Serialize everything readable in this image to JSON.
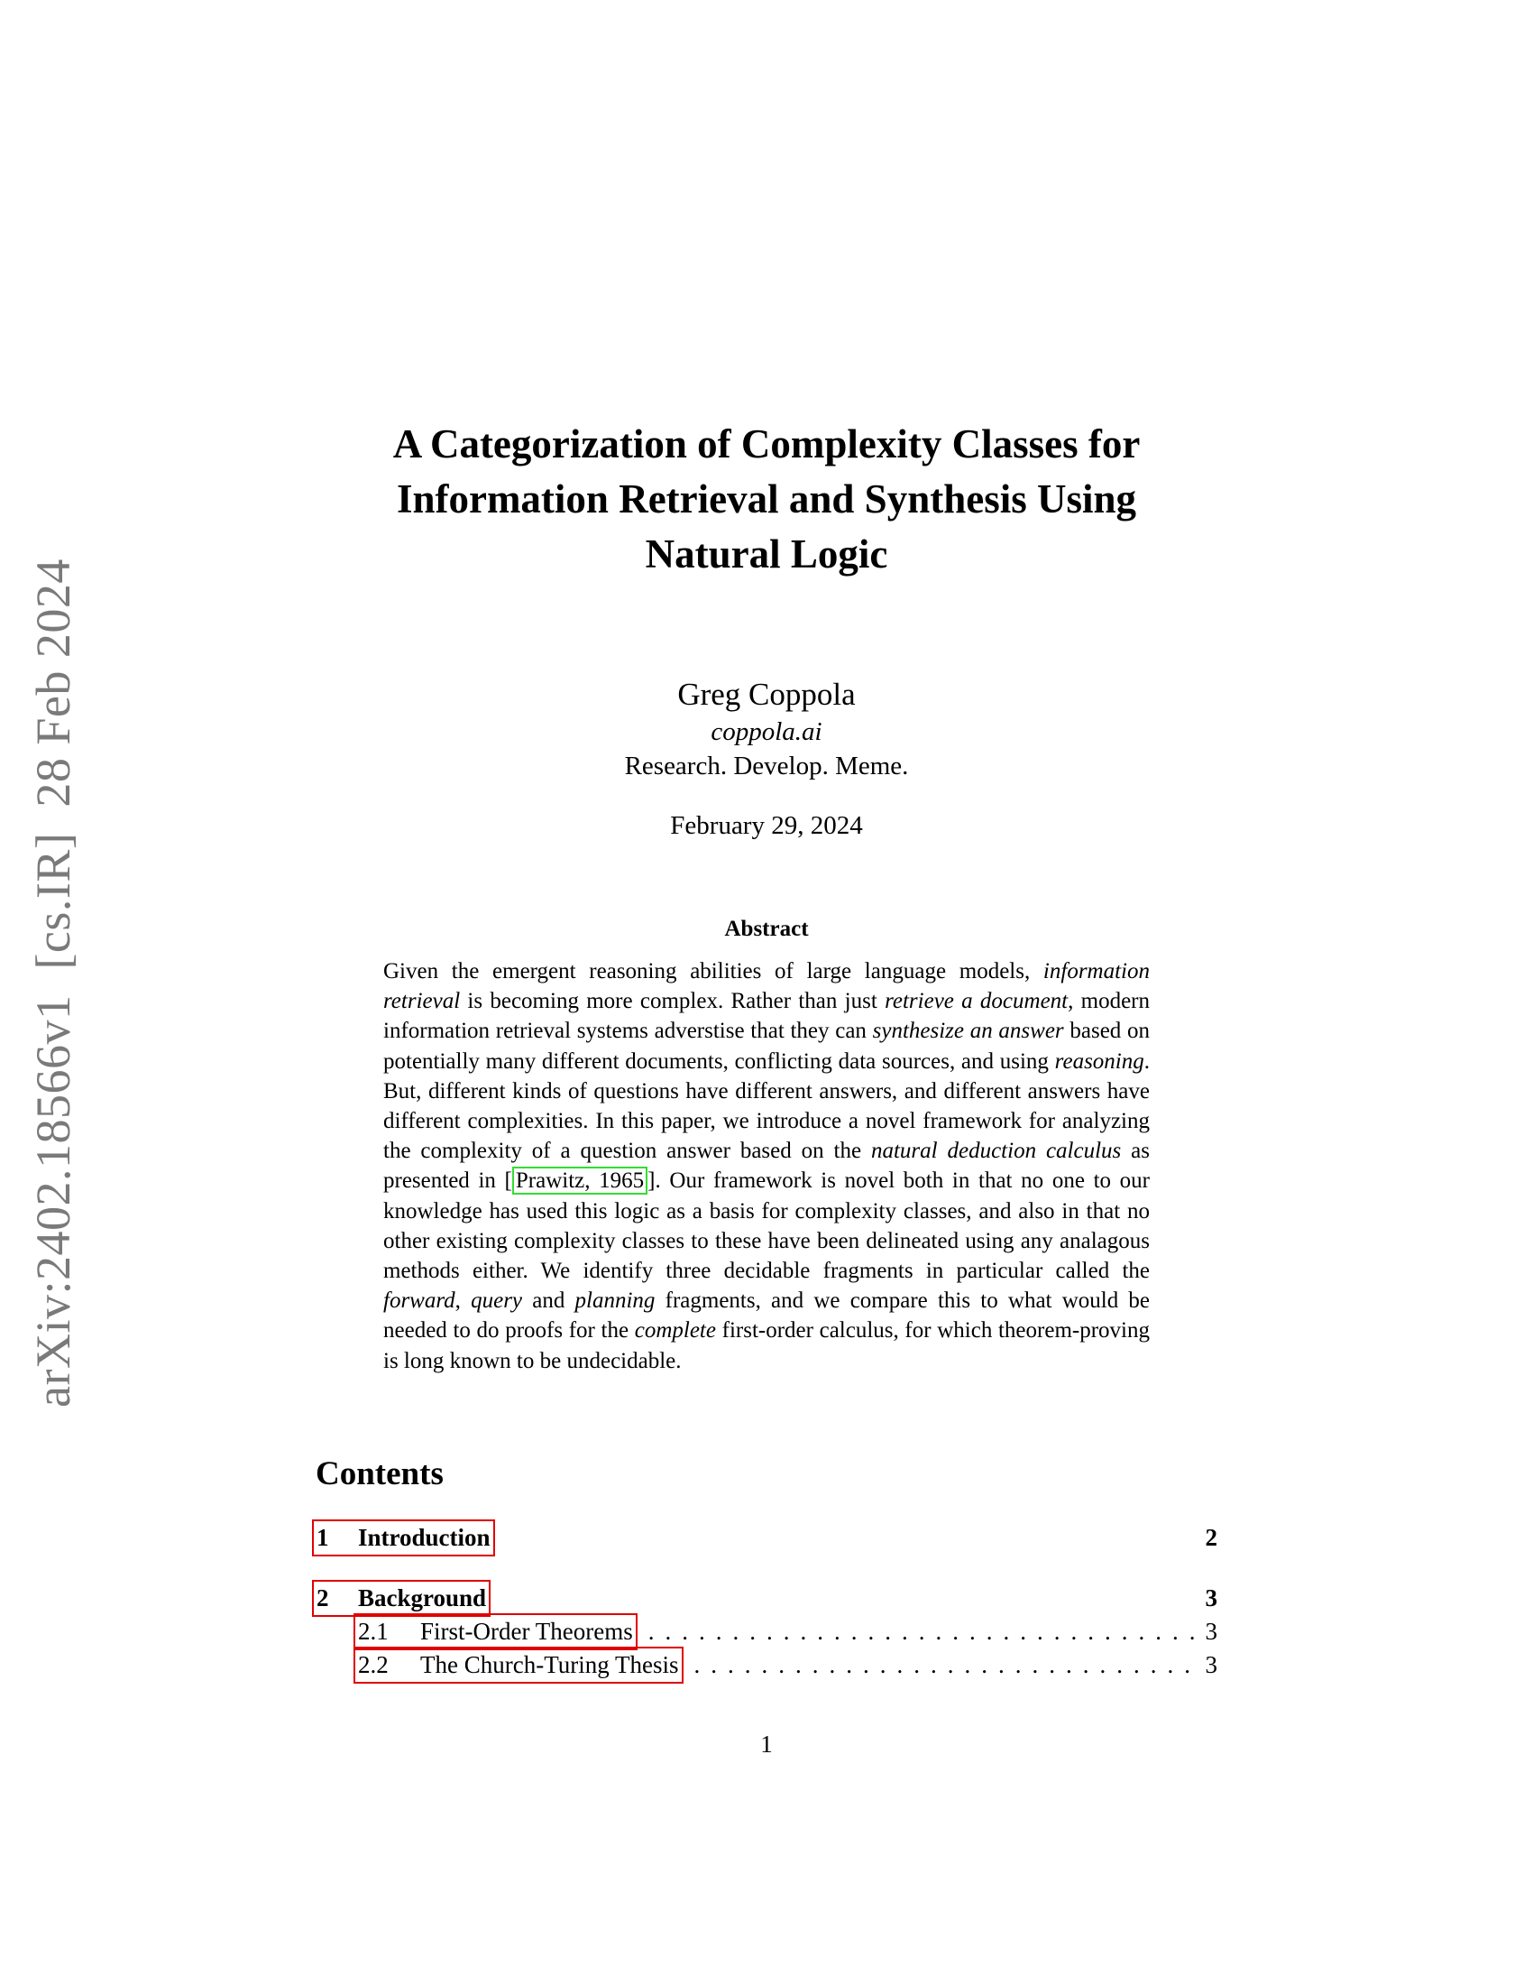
{
  "arxiv_stamp": "arXiv:2402.18566v1  [cs.IR]  28 Feb 2024",
  "title": {
    "lines": [
      "A Categorization of Complexity Classes for",
      "Information Retrieval and Synthesis Using",
      "Natural Logic"
    ]
  },
  "author": {
    "name": "Greg Coppola",
    "affiliation": "coppola.ai",
    "motto": "Research. Develop. Meme.",
    "date": "February 29, 2024"
  },
  "abstract": {
    "heading": "Abstract",
    "segments": [
      {
        "text": "Given the emergent reasoning abilities of large language models, ",
        "style": "normal"
      },
      {
        "text": "information retrieval",
        "style": "italic"
      },
      {
        "text": " is becoming more complex. Rather than just ",
        "style": "normal"
      },
      {
        "text": "retrieve a document",
        "style": "italic"
      },
      {
        "text": ", modern information retrieval systems adverstise that they can ",
        "style": "normal"
      },
      {
        "text": "synthesize an answer",
        "style": "italic"
      },
      {
        "text": " based on potentially many different documents, conflicting data sources, and using ",
        "style": "normal"
      },
      {
        "text": "reasoning",
        "style": "italic"
      },
      {
        "text": ". But, different kinds of questions have different answers, and different answers have different complexities. In this paper, we introduce a novel framework for analyzing the complexity of a question answer based on the ",
        "style": "normal"
      },
      {
        "text": "natural deduction calculus",
        "style": "italic"
      },
      {
        "text": " as presented in [",
        "style": "normal"
      },
      {
        "text": "Prawitz, 1965",
        "style": "citation"
      },
      {
        "text": "]. Our framework is novel both in that no one to our knowledge has used this logic as a basis for complexity classes, and also in that no other existing complexity classes to these have been delineated using any analagous methods either. We identify three decidable fragments in particular called the ",
        "style": "normal"
      },
      {
        "text": "forward",
        "style": "italic"
      },
      {
        "text": ", ",
        "style": "normal"
      },
      {
        "text": "query",
        "style": "italic"
      },
      {
        "text": " and ",
        "style": "normal"
      },
      {
        "text": "planning",
        "style": "italic"
      },
      {
        "text": " fragments, and we compare this to what would be needed to do proofs for the ",
        "style": "normal"
      },
      {
        "text": "complete",
        "style": "italic"
      },
      {
        "text": " first-order calculus, for which theorem-proving is long known to be undecidable.",
        "style": "normal"
      }
    ]
  },
  "contents": {
    "heading": "Contents",
    "entries": [
      {
        "level": "section",
        "number": "1",
        "title": "Introduction",
        "page": "2",
        "has_sub": false
      },
      {
        "level": "section",
        "number": "2",
        "title": "Background",
        "page": "3",
        "has_sub": true
      },
      {
        "level": "sub",
        "number": "2.1",
        "title": "First-Order Theorems",
        "page": "3"
      },
      {
        "level": "sub",
        "number": "2.2",
        "title": "The Church-Turing Thesis",
        "page": "3"
      }
    ]
  },
  "colors": {
    "toc_link_border": "#e00000",
    "citation_border": "#33dd33",
    "arxiv_stamp": "#7a7a7a"
  },
  "page_number": "1"
}
